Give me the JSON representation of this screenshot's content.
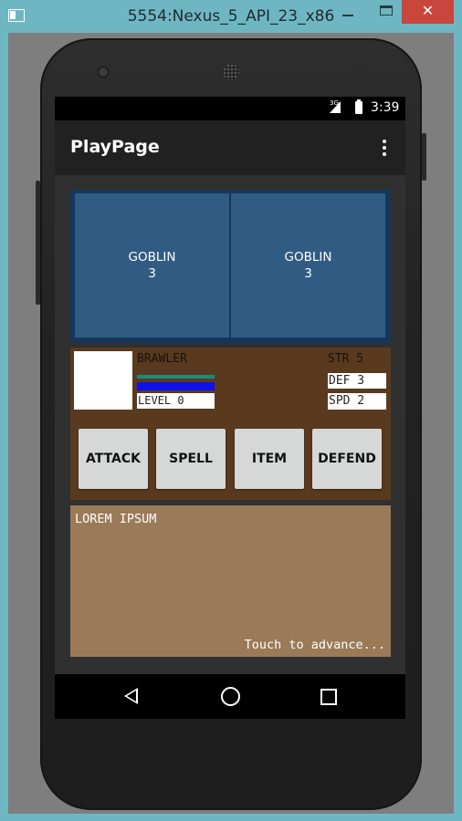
{
  "window": {
    "title": "5554:Nexus_5_API_23_x86",
    "close_label": "✕"
  },
  "status_bar": {
    "network": "3G",
    "time": "3:39"
  },
  "app_bar": {
    "title": "PlayPage"
  },
  "enemies": [
    {
      "name": "GOBLIN",
      "count": "3"
    },
    {
      "name": "GOBLIN",
      "count": "3"
    }
  ],
  "player": {
    "class": "BRAWLER",
    "level": "LEVEL 0",
    "str": "STR 5",
    "def": "DEF 3",
    "spd": "SPD 2",
    "colors": {
      "hp_bar": "#1a8a7a",
      "mp_bar": "#1010e8"
    }
  },
  "actions": {
    "attack": "ATTACK",
    "spell": "SPELL",
    "item": "ITEM",
    "defend": "DEFEND"
  },
  "dialog": {
    "text": "LOREM IPSUM",
    "hint": "Touch to advance..."
  },
  "nav": {
    "back_icon": "back-triangle",
    "home_icon": "home-circle",
    "recents_icon": "recents-square"
  }
}
